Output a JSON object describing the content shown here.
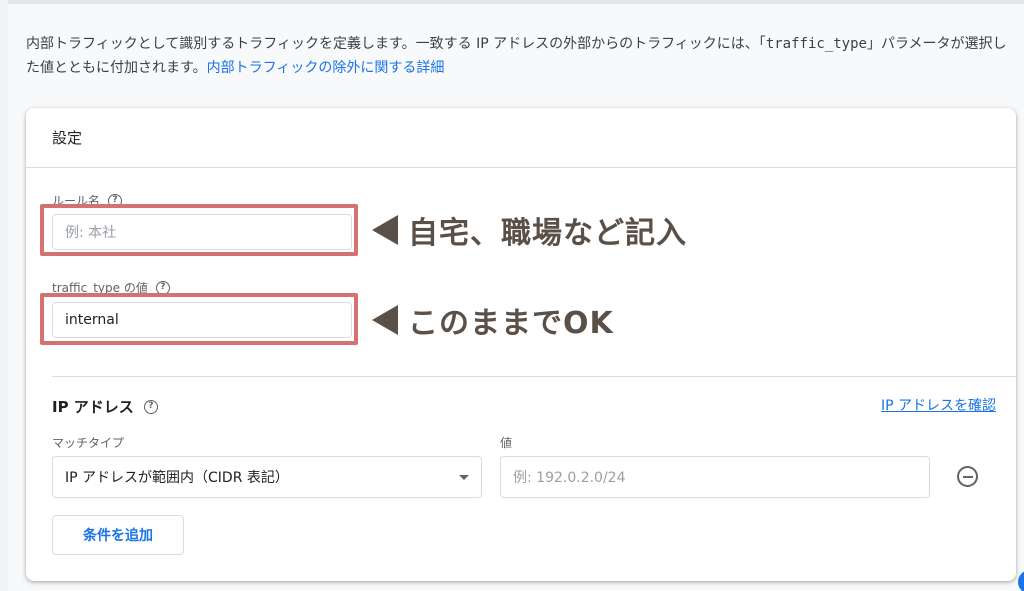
{
  "description": {
    "text_before": "内部トラフィックとして識別するトラフィックを定義します。一致する IP アドレスの外部からのトラフィックには、「",
    "param": "traffic_type",
    "text_after": "」パラメータが選択した値とともに付加されます。",
    "link": "内部トラフィックの除外に関する詳細"
  },
  "card": {
    "title": "設定",
    "rule_name": {
      "label": "ルール名",
      "placeholder": "例: 本社",
      "value": ""
    },
    "traffic_type": {
      "label": "traffic_type の値",
      "value": "internal"
    },
    "ip_section": {
      "title": "IP アドレス",
      "check_link": "IP アドレスを確認",
      "match_type_label": "マッチタイプ",
      "match_type_value": "IP アドレスが範囲内（CIDR 表記）",
      "value_label": "値",
      "value_placeholder": "例: 192.0.2.0/24",
      "add_condition": "条件を追加"
    }
  },
  "annotations": {
    "rule_name_note": "自宅、職場など記入",
    "traffic_type_note": "このままでOK",
    "highlight_color": "#d47272"
  },
  "colors": {
    "link": "#1a73e8",
    "border": "#dadce0"
  },
  "icons": [
    "help-icon",
    "chevron-down-icon",
    "remove-circle-icon",
    "arrow-left-icon"
  ]
}
